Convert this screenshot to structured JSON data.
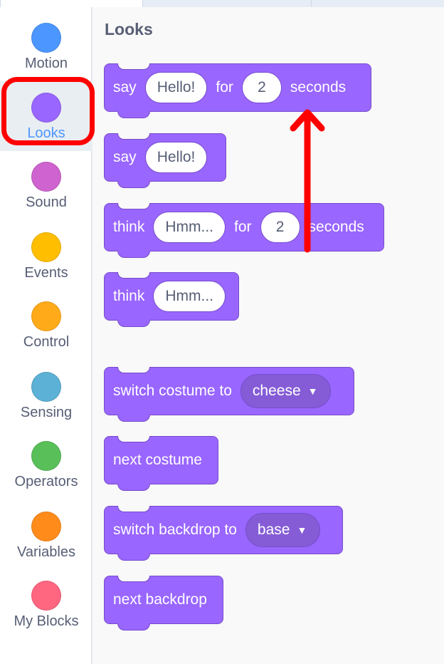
{
  "palette": {
    "title": "Looks"
  },
  "categories": [
    {
      "label": "Motion",
      "color": "#4c97ff"
    },
    {
      "label": "Looks",
      "color": "#9966ff",
      "selected": true
    },
    {
      "label": "Sound",
      "color": "#cf63cf"
    },
    {
      "label": "Events",
      "color": "#ffbf00"
    },
    {
      "label": "Control",
      "color": "#ffab19"
    },
    {
      "label": "Sensing",
      "color": "#5cb1d6"
    },
    {
      "label": "Operators",
      "color": "#59c059"
    },
    {
      "label": "Variables",
      "color": "#ff8c1a"
    },
    {
      "label": "My Blocks",
      "color": "#ff6680"
    }
  ],
  "blocks": {
    "say_for": {
      "w1": "say",
      "input1": "Hello!",
      "w2": "for",
      "input2": "2",
      "w3": "seconds"
    },
    "say": {
      "w1": "say",
      "input1": "Hello!"
    },
    "think_for": {
      "w1": "think",
      "input1": "Hmm...",
      "w2": "for",
      "input2": "2",
      "w3": "seconds"
    },
    "think": {
      "w1": "think",
      "input1": "Hmm..."
    },
    "switch_costume": {
      "w1": "switch costume to",
      "menu": "cheese"
    },
    "next_costume": {
      "w1": "next costume"
    },
    "switch_backdrop": {
      "w1": "switch backdrop to",
      "menu": "base"
    },
    "next_backdrop": {
      "w1": "next backdrop"
    }
  },
  "colors": {
    "looks_block": "#9966ff",
    "looks_block_border": "#774dcb",
    "selected_label": "#4c97ff",
    "annotation": "#ff0000"
  },
  "icons": {
    "dropdown": "caret-down-icon",
    "annotation_arrow": "up-arrow-icon"
  }
}
